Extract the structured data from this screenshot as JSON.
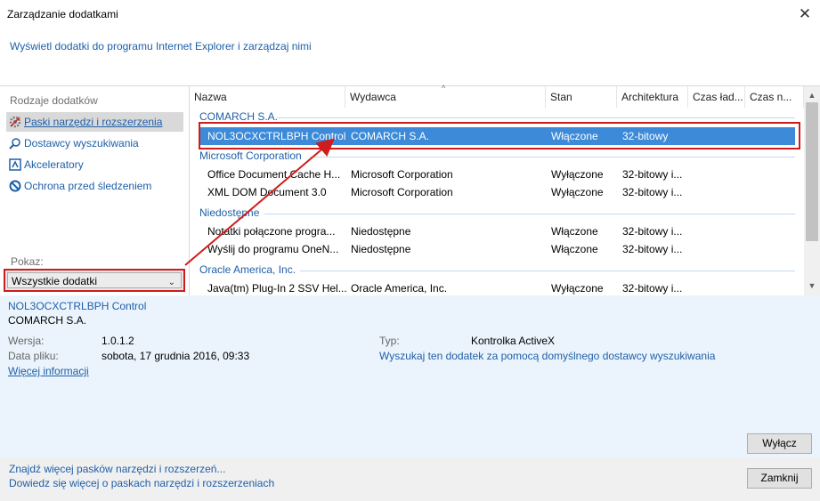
{
  "window": {
    "title": "Zarządzanie dodatkami",
    "subtitle": "Wyświetl dodatki do programu Internet Explorer i zarządzaj nimi"
  },
  "left_pane": {
    "heading": "Rodzaje dodatków",
    "items": [
      {
        "label": "Paski narzędzi i rozszerzenia",
        "icon": "gear-icon",
        "selected": true
      },
      {
        "label": "Dostawcy wyszukiwania",
        "icon": "search-icon",
        "selected": false
      },
      {
        "label": "Akceleratory",
        "icon": "accelerator-icon",
        "selected": false
      },
      {
        "label": "Ochrona przed śledzeniem",
        "icon": "block-icon",
        "selected": false
      }
    ],
    "show_label": "Pokaz:",
    "show_value": "Wszystkie dodatki"
  },
  "list": {
    "columns": [
      "Nazwa",
      "Wydawca",
      "Stan",
      "Architektura",
      "Czas ład...",
      "Czas n..."
    ],
    "groups": [
      {
        "name": "COMARCH S.A.",
        "rows": [
          {
            "name": "NOL3OCXCTRLBPH Control",
            "publisher": "COMARCH S.A.",
            "status": "Włączone",
            "arch": "32-bitowy",
            "selected": true
          }
        ]
      },
      {
        "name": "Microsoft Corporation",
        "rows": [
          {
            "name": "Office Document Cache H...",
            "publisher": "Microsoft Corporation",
            "status": "Wyłączone",
            "arch": "32-bitowy i..."
          },
          {
            "name": "XML DOM Document 3.0",
            "publisher": "Microsoft Corporation",
            "status": "Wyłączone",
            "arch": "32-bitowy i..."
          }
        ]
      },
      {
        "name": "Niedostępne",
        "rows": [
          {
            "name": "Notatki połączone progra...",
            "publisher": "Niedostępne",
            "status": "Włączone",
            "arch": "32-bitowy i..."
          },
          {
            "name": "Wyślij do programu OneN...",
            "publisher": "Niedostępne",
            "status": "Włączone",
            "arch": "32-bitowy i..."
          }
        ]
      },
      {
        "name": "Oracle America, Inc.",
        "rows": [
          {
            "name": "Java(tm) Plug-In 2 SSV Hel...",
            "publisher": "Oracle America, Inc.",
            "status": "Wyłączone",
            "arch": "32-bitowy i..."
          }
        ]
      }
    ]
  },
  "details": {
    "name": "NOL3OCXCTRLBPH Control",
    "publisher": "COMARCH S.A.",
    "version_label": "Wersja:",
    "version_value": "1.0.1.2",
    "date_label": "Data pliku:",
    "date_value": "sobota, 17 grudnia 2016, 09:33",
    "more_info": "Więcej informacji",
    "type_label": "Typ:",
    "type_value": "Kontrolka ActiveX",
    "search_link": "Wyszukaj ten dodatek za pomocą domyślnego dostawcy wyszukiwania",
    "disable_button": "Wyłącz"
  },
  "footer": {
    "link1": "Znajdź więcej pasków narzędzi i rozszerzeń...",
    "link2": "Dowiedz się więcej o paskach narzędzi i rozszerzeniach",
    "close_button": "Zamknij"
  },
  "colors": {
    "link": "#1e5fa8",
    "selection": "#3c8ad8",
    "annotation": "#d01c1c",
    "details_bg": "#ebf4fc"
  }
}
